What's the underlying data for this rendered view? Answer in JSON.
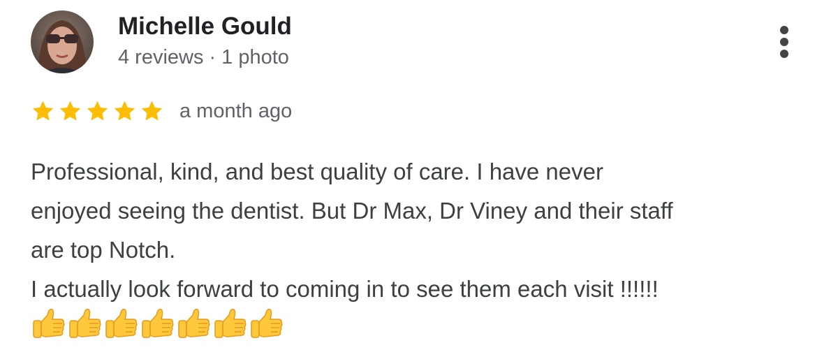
{
  "reviewer": {
    "name": "Michelle Gould",
    "reviews": "4 reviews",
    "separator": "·",
    "photos": "1 photo",
    "avatar": "profile-photo"
  },
  "menu": {
    "icon": "more-vert-icon"
  },
  "rating": {
    "stars": 5,
    "max": 5,
    "icon": "star-icon",
    "color": "#FBBC04",
    "date": "a month ago"
  },
  "review": {
    "lines": [
      "Professional, kind, and best quality of care. I have never",
      "enjoyed seeing the dentist. But Dr Max, Dr Viney and their staff",
      "are top Notch.",
      "I actually look forward to coming in to see them each visit !!!!!!"
    ],
    "emoji_count": 7,
    "emoji_icon": "thumbs-up-icon",
    "emoji_color": "#FFC83D"
  },
  "colors": {
    "name": "#202124",
    "meta": "#5f6368",
    "body": "#3c4043",
    "menu": "#444444"
  }
}
